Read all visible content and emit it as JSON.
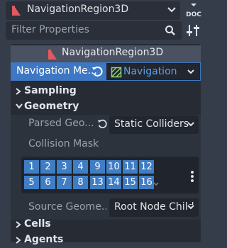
{
  "inspector": {
    "node_selector": {
      "label": "NavigationRegion3D"
    },
    "filter": {
      "placeholder": "Filter Properties"
    }
  },
  "node_header": {
    "title": "NavigationRegion3D"
  },
  "resource": {
    "property_label": "Navigation Me...",
    "value_label": "Navigation"
  },
  "categories": {
    "sampling": "Sampling",
    "geometry": "Geometry",
    "cells": "Cells",
    "agents": "Agents"
  },
  "geometry": {
    "parsed": {
      "label": "Parsed Geo...",
      "value": "Static Colliders"
    },
    "collision_mask": {
      "label": "Collision Mask",
      "bits": [
        "1",
        "2",
        "3",
        "4",
        "9",
        "10",
        "11",
        "12",
        "5",
        "6",
        "7",
        "8",
        "13",
        "14",
        "15",
        "16"
      ]
    },
    "source": {
      "label": "Source Geome...",
      "value": "Root Node Child"
    }
  },
  "colors": {
    "accent": "#3e78c4",
    "node_icon": "#e05a5f",
    "link": "#5fa0e8",
    "mesh_icon": "#8dd472"
  }
}
